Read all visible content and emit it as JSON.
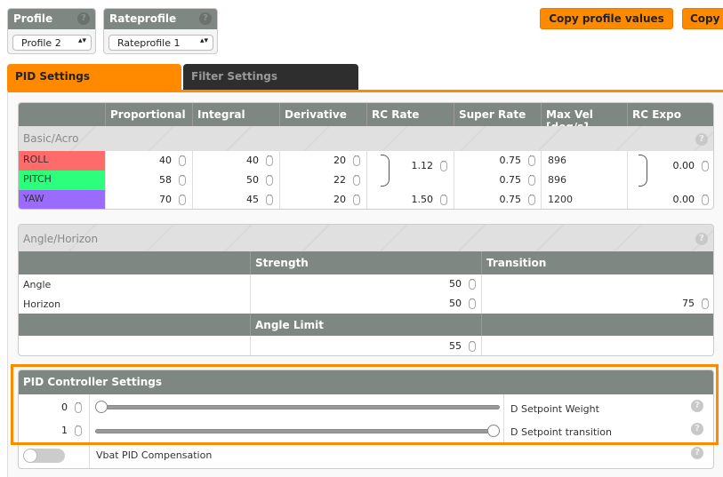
{
  "profile": {
    "title": "Profile",
    "selected": "Profile 2"
  },
  "rateprofile": {
    "title": "Rateprofile",
    "selected": "Rateprofile 1"
  },
  "buttons": {
    "copy_profile": "Copy profile values",
    "copy_rate": "Copy r"
  },
  "tabs": [
    {
      "label": "PID Settings",
      "active": true
    },
    {
      "label": "Filter Settings",
      "active": false
    }
  ],
  "pid_table": {
    "headers": [
      "",
      "Proportional",
      "Integral",
      "Derivative",
      "RC Rate",
      "Super Rate",
      "Max Vel [deg/s]",
      "RC Expo"
    ],
    "section": "Basic/Acro",
    "rows": [
      {
        "name": "ROLL",
        "color": "#ff6b6b",
        "p": "40",
        "i": "40",
        "d": "20",
        "super": "0.75",
        "maxvel": "896"
      },
      {
        "name": "PITCH",
        "color": "#2bff7c",
        "p": "58",
        "i": "50",
        "d": "22",
        "super": "0.75",
        "maxvel": "896"
      },
      {
        "name": "YAW",
        "color": "#9b6bff",
        "p": "70",
        "i": "45",
        "d": "20",
        "super": "0.75",
        "maxvel": "1200"
      }
    ],
    "rc_rate_rollpitch": "1.12",
    "rc_rate_yaw": "1.50",
    "rc_expo_rollpitch": "0.00",
    "rc_expo_yaw": "0.00"
  },
  "angle_table": {
    "section": "Angle/Horizon",
    "strength": "Strength",
    "transition": "Transition",
    "angle_label": "Angle",
    "horizon_label": "Horizon",
    "angle_strength": "50",
    "horizon_strength": "50",
    "horizon_transition": "75",
    "angle_limit_label": "Angle Limit",
    "angle_limit": "55"
  },
  "controller": {
    "title": "PID Controller Settings",
    "d_setpoint_weight": {
      "value": "0",
      "label": "D Setpoint Weight",
      "slider_fraction": 0
    },
    "d_setpoint_transition": {
      "value": "1",
      "label": "D Setpoint transition",
      "slider_fraction": 1
    },
    "vbat": {
      "label": "Vbat PID Compensation",
      "enabled": false
    }
  },
  "colors": {
    "accent": "#ff8a00",
    "header": "#7f8782"
  }
}
